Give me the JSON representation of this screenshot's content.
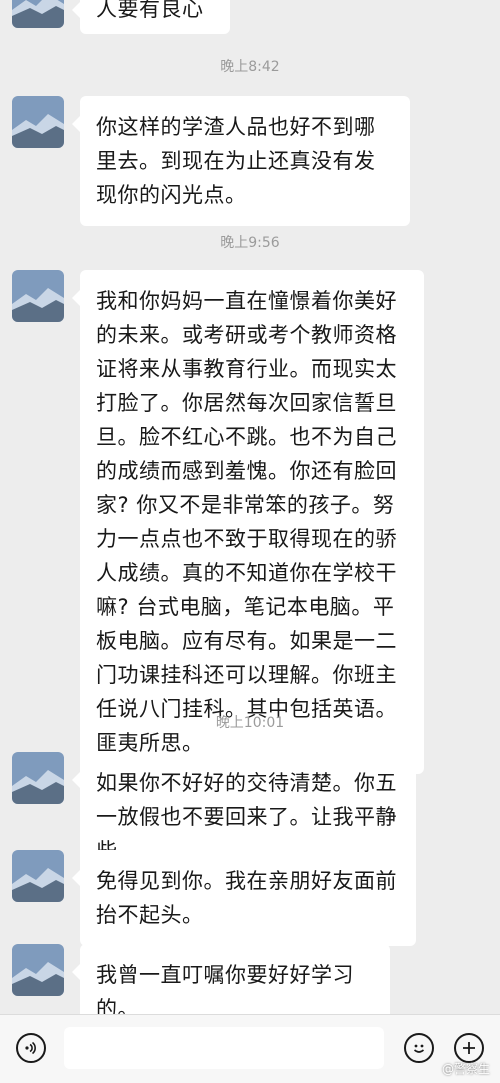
{
  "top": {
    "partial_text": "人要有良心"
  },
  "messages": [
    {
      "time": "晚上8:42",
      "text": "你这样的学渣人品也好不到哪里去。到现在为止还真没有发现你的闪光点。"
    },
    {
      "time": "晚上9:56",
      "text": "我和你妈妈一直在憧憬着你美好的未来。或考研或考个教师资格证将来从事教育行业。而现实太打脸了。你居然每次回家信誓旦旦。脸不红心不跳。也不为自己的成绩而感到羞愧。你还有脸回家? 你又不是非常笨的孩子。努力一点点也不致于取得现在的骄人成绩。真的不知道你在学校干嘛? 台式电脑，笔记本电脑。平板电脑。应有尽有。如果是一二门功课挂科还可以理解。你班主任说八门挂科。其中包括英语。匪夷所思。"
    },
    {
      "time": "晚上10:01",
      "text": "如果你不好好的交待清楚。你五一放假也不要回来了。让我平静些。"
    },
    {
      "time": "",
      "text": "免得见到你。我在亲朋好友面前抬不起头。"
    },
    {
      "time": "",
      "text": "我曾一直叮嘱你要好好学习的。"
    }
  ],
  "watermark": "@警察生",
  "icons": {
    "voice": "voice-icon",
    "emoji": "emoji-icon",
    "plus": "plus-icon"
  }
}
